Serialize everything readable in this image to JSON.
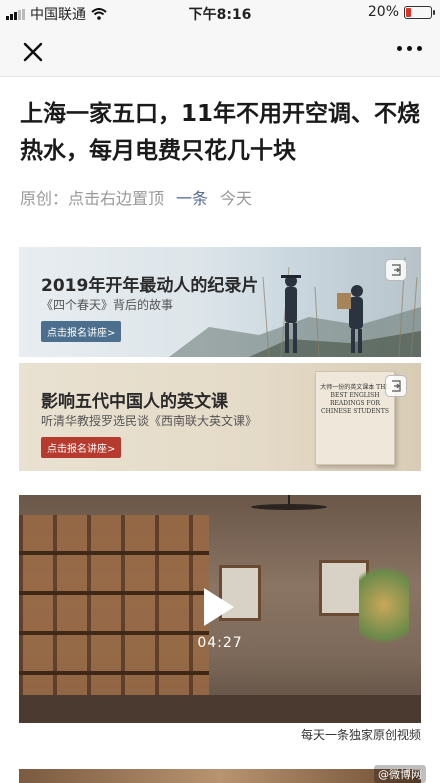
{
  "status_bar": {
    "carrier": "中国联通",
    "time": "下午8:16",
    "battery_percent": "20%",
    "battery_level": 0.2
  },
  "article": {
    "title": "上海一家五口，11年不用开空调、不烧热水，每月电费只花几十块",
    "meta": {
      "original_label": "原创：",
      "pin_hint": "点击右边置顶",
      "author": "一条",
      "date": "今天"
    }
  },
  "banners": [
    {
      "title": "2019年开年最动人的纪录片",
      "subtitle": "《四个春天》背后的故事",
      "button": "点击报名讲座>"
    },
    {
      "title": "影响五代中国人的英文课",
      "subtitle": "听清华教授罗选民谈《西南联大英文课》",
      "button": "点击报名讲座>",
      "book_text": "大师一份的英文课本 THE BEST ENGLISH READINGS FOR CHINESE STUDENTS"
    }
  ],
  "video": {
    "duration": "04:27",
    "caption": "每天一条独家原创视频"
  },
  "watermark": "@微博网"
}
